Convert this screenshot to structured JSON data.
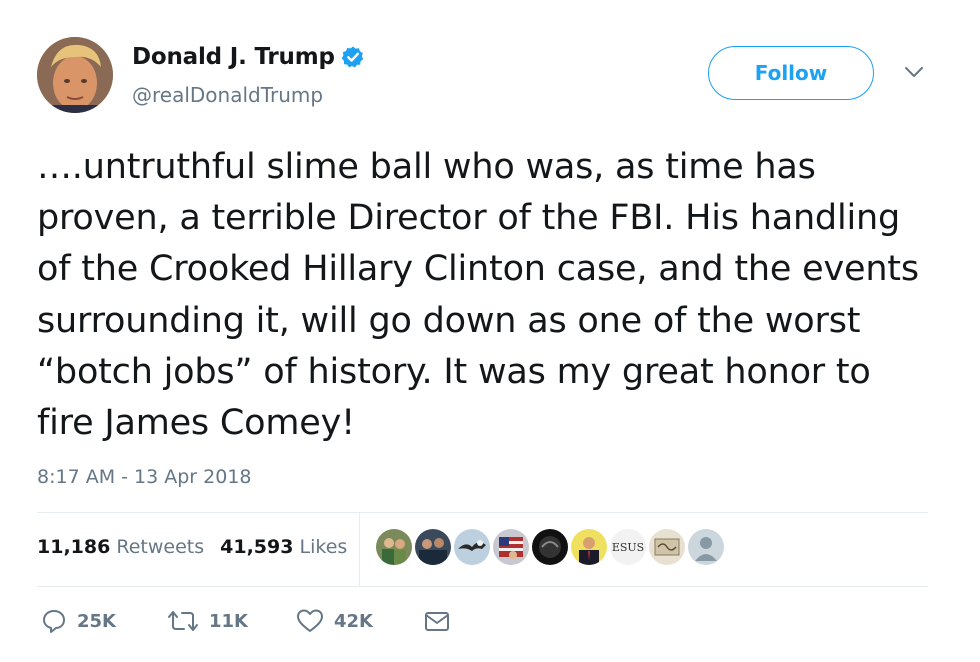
{
  "author": {
    "name": "Donald J. Trump",
    "handle": "@realDonaldTrump",
    "verified": true,
    "avatar_icon": "profile-photo"
  },
  "follow_label": "Follow",
  "tweet_text": "….untruthful slime ball who was, as time has proven, a terrible Director of the FBI. His handling of the Crooked Hillary Clinton case, and the events surrounding it, will go down as one of the worst “botch jobs” of history. It was my great honor to fire James Comey!",
  "timestamp": "8:17 AM - 13 Apr 2018",
  "stats": {
    "retweets_count": "11,186",
    "retweets_label": "Retweets",
    "likes_count": "41,593",
    "likes_label": "Likes"
  },
  "likers": [
    {
      "icon": "liker-avatar-1"
    },
    {
      "icon": "liker-avatar-2"
    },
    {
      "icon": "liker-avatar-3"
    },
    {
      "icon": "liker-avatar-4"
    },
    {
      "icon": "liker-avatar-5"
    },
    {
      "icon": "liker-avatar-6"
    },
    {
      "icon": "liker-avatar-7",
      "text": "ESUS"
    },
    {
      "icon": "liker-avatar-8"
    },
    {
      "icon": "default-avatar-icon"
    }
  ],
  "actions": {
    "reply_count": "25K",
    "retweet_count": "11K",
    "like_count": "42K"
  },
  "colors": {
    "accent": "#1da1f2",
    "text": "#14171a",
    "secondary": "#657786",
    "divider": "#e6ecf0"
  }
}
